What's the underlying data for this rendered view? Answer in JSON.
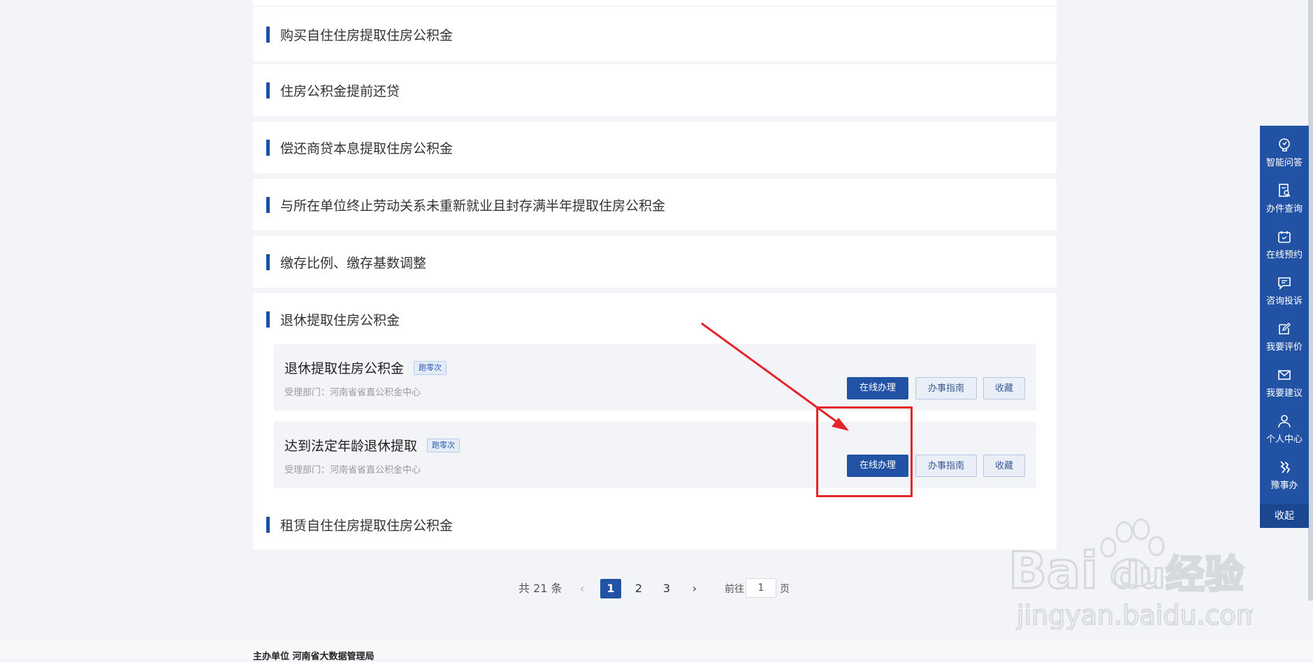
{
  "list": {
    "items": [
      {
        "label": "购买自住住房提取住房公积金"
      },
      {
        "label": "住房公积金提前还贷"
      },
      {
        "label": "偿还商贷本息提取住房公积金"
      },
      {
        "label": "与所在单位终止劳动关系未重新就业且封存满半年提取住房公积金"
      },
      {
        "label": "缴存比例、缴存基数调整"
      },
      {
        "label": "退休提取住房公积金"
      },
      {
        "label": "租赁自住住房提取住房公积金"
      }
    ],
    "expanded": {
      "subitems": [
        {
          "title": "退休提取住房公积金",
          "tag": "跑零次",
          "dept": "受理部门：河南省省直公积金中心"
        },
        {
          "title": "达到法定年龄退休提取",
          "tag": "跑零次",
          "dept": "受理部门：河南省省直公积金中心"
        }
      ]
    }
  },
  "buttons": {
    "online": "在线办理",
    "guide": "办事指南",
    "favorite": "收藏"
  },
  "sidebar": {
    "items": [
      {
        "label": "智能问答",
        "icon": "brain-icon"
      },
      {
        "label": "办件查询",
        "icon": "document-search-icon"
      },
      {
        "label": "在线预约",
        "icon": "calendar-icon"
      },
      {
        "label": "咨询投诉",
        "icon": "chat-icon"
      },
      {
        "label": "我要评价",
        "icon": "edit-icon"
      },
      {
        "label": "我要建议",
        "icon": "mail-icon"
      },
      {
        "label": "个人中心",
        "icon": "user-icon"
      },
      {
        "label": "豫事办",
        "icon": "yu-logo-icon"
      }
    ],
    "collapse": "收起"
  },
  "pagination": {
    "total": "共 21 条",
    "pages": [
      "1",
      "2",
      "3"
    ],
    "current": "1",
    "prev": "‹",
    "next": "›",
    "goto_label": "前往",
    "goto_value": "1",
    "unit": "页"
  },
  "footer": {
    "text": "主办单位  河南省大数据管理局"
  },
  "watermark": {
    "brand": "Baidu经验",
    "url": "jingyan.baidu.com"
  },
  "colors": {
    "primary": "#2152a4",
    "annotation": "#e5252a"
  }
}
